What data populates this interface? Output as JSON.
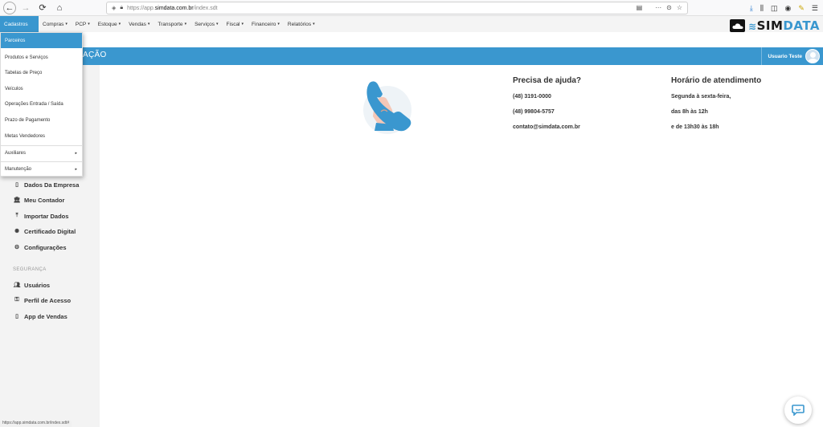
{
  "browser": {
    "url_prefix": "https://app.",
    "url_host": "simdata.com.br",
    "url_path": "/index.sdt",
    "status_url": "https://app.simdata.com.br/index.sdt#"
  },
  "menu": {
    "items": [
      {
        "label": "Cadastros",
        "caret": ""
      },
      {
        "label": "Compras",
        "caret": "▾"
      },
      {
        "label": "PCP",
        "caret": "▾"
      },
      {
        "label": "Estoque",
        "caret": "▾"
      },
      {
        "label": "Vendas",
        "caret": "▾"
      },
      {
        "label": "Transporte",
        "caret": "▾"
      },
      {
        "label": "Serviços",
        "caret": "▾"
      },
      {
        "label": "Fiscal",
        "caret": "▾"
      },
      {
        "label": "Financeiro",
        "caret": "▾"
      },
      {
        "label": "Relatórios",
        "caret": "▾"
      }
    ]
  },
  "logo": {
    "part1": "SIM",
    "part2": "DATA"
  },
  "title_bar": {
    "title": "AÇÃO",
    "user_name": "Usuario Teste"
  },
  "dropdown": {
    "items": [
      {
        "label": "Parceiros"
      },
      {
        "label": "Produtos e Serviços"
      },
      {
        "label": "Tabelas de Preço"
      },
      {
        "label": "Veículos"
      },
      {
        "label": "Operações Entrada / Saída"
      },
      {
        "label": "Prazo de Pagamento"
      },
      {
        "label": "Metas Vendedores"
      },
      {
        "label": "Auxiliares",
        "arrow": "▸"
      },
      {
        "label": "Manutenção",
        "arrow": "▸"
      }
    ]
  },
  "sidebar": {
    "items": [
      {
        "label": "Dados Da Empresa",
        "icon": "building-icon"
      },
      {
        "label": "Meu Contador",
        "icon": "bank-icon"
      },
      {
        "label": "Importar Dados",
        "icon": "upload-icon"
      },
      {
        "label": "Certificado Digital",
        "icon": "certificate-icon"
      },
      {
        "label": "Configurações",
        "icon": "gears-icon"
      }
    ],
    "security_header": "SEGURANÇA",
    "security_items": [
      {
        "label": "Usuários",
        "icon": "users-icon"
      },
      {
        "label": "Perfil de Acesso",
        "icon": "key-icon"
      },
      {
        "label": "App de Vendas",
        "icon": "mobile-icon"
      }
    ]
  },
  "help": {
    "title": "Precisa de ajuda?",
    "phone1": "(48) 3191-0000",
    "phone2": "(48) 99804-5757",
    "email": "contato@simdata.com.br"
  },
  "hours": {
    "title": "Horário de atendimento",
    "line1": "Segunda à sexta-feira,",
    "line2": "das 8h às 12h",
    "line3": "e de 13h30 às 18h"
  },
  "colors": {
    "accent": "#3a97cf"
  }
}
